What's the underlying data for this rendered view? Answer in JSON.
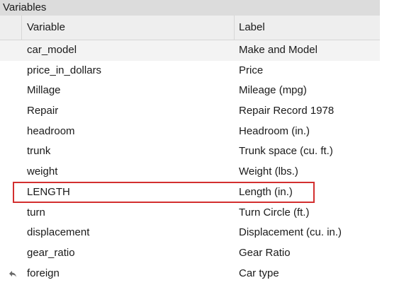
{
  "panel": {
    "title": "Variables"
  },
  "columns": {
    "variable": "Variable",
    "label": "Label"
  },
  "rows": [
    {
      "variable": "car_model",
      "label": "Make and Model"
    },
    {
      "variable": "price_in_dollars",
      "label": "Price"
    },
    {
      "variable": "Millage",
      "label": "Mileage (mpg)"
    },
    {
      "variable": "Repair",
      "label": "Repair Record 1978"
    },
    {
      "variable": "headroom",
      "label": "Headroom (in.)"
    },
    {
      "variable": "trunk",
      "label": "Trunk space (cu. ft.)"
    },
    {
      "variable": "weight",
      "label": "Weight (lbs.)"
    },
    {
      "variable": "LENGTH",
      "label": "Length (in.)"
    },
    {
      "variable": "turn",
      "label": "Turn Circle (ft.)"
    },
    {
      "variable": "displacement",
      "label": "Displacement (cu. in.)"
    },
    {
      "variable": "gear_ratio",
      "label": "Gear Ratio"
    },
    {
      "variable": "foreign",
      "label": "Car type",
      "icon": "reply-arrow-icon"
    }
  ],
  "annotation": {
    "highlight_color": "#d32f2f",
    "highlighted_variable": "LENGTH"
  }
}
